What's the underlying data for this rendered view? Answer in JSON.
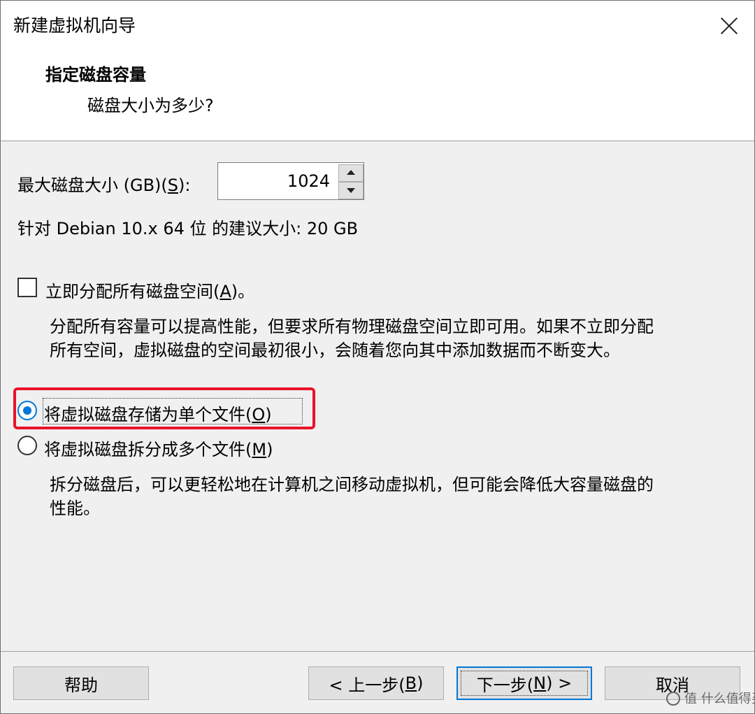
{
  "window": {
    "title": "新建虚拟机向导"
  },
  "header": {
    "step_title": "指定磁盘容量",
    "step_subtitle": "磁盘大小为多少?"
  },
  "disk_size": {
    "label_pre": "最大磁盘大小 (GB)(",
    "label_key": "S",
    "label_post": "):",
    "value": "1024"
  },
  "recommendation": "针对 Debian 10.x 64 位 的建议大小: 20 GB",
  "allocate_all": {
    "label_pre": "立即分配所有磁盘空间(",
    "label_key": "A",
    "label_post": ")。",
    "checked": false,
    "desc_line1": "分配所有容量可以提高性能，但要求所有物理磁盘空间立即可用。如果不立即分配",
    "desc_line2": "所有空间，虚拟磁盘的空间最初很小，会随着您向其中添加数据而不断变大。"
  },
  "single_file": {
    "label_pre": "将虚拟磁盘存储为单个文件(",
    "label_key": "O",
    "label_post": ")",
    "selected": true
  },
  "split_files": {
    "label_pre": "将虚拟磁盘拆分成多个文件(",
    "label_key": "M",
    "label_post": ")",
    "selected": false,
    "desc_line1": "拆分磁盘后，可以更轻松地在计算机之间移动虚拟机，但可能会降低大容量磁盘的",
    "desc_line2": "性能。"
  },
  "buttons": {
    "help": "帮助",
    "back_pre": "< 上一步(",
    "back_key": "B",
    "back_post": ")",
    "next_pre": "下一步(",
    "next_key": "N",
    "next_post": ") >",
    "cancel": "取消"
  },
  "watermark": "值 什么值得买",
  "colors": {
    "accent": "#0078d7",
    "highlight": "#e8142a"
  },
  "icons": {
    "close": "close-icon",
    "spin_up": "arrow-up-icon",
    "spin_down": "arrow-down-icon"
  }
}
